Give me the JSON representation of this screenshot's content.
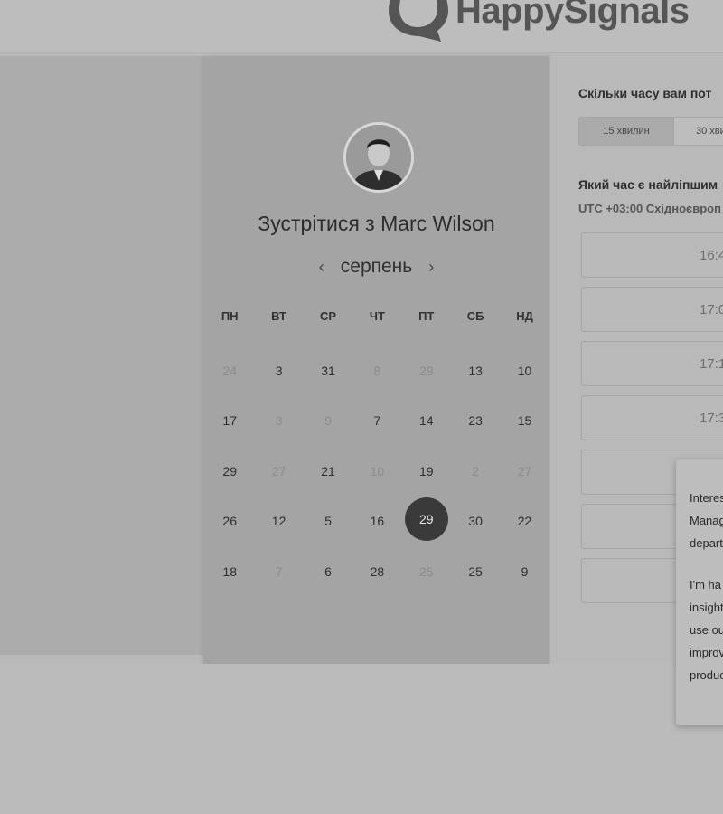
{
  "header": {
    "logo_text": "HappySignals",
    "logo_icon": "happysignals-logo-icon"
  },
  "calendar": {
    "avatar_icon": "profile-photo",
    "title": "Зустрітися з Marc Wilson",
    "month": "серпень",
    "prev_icon": "chevron-left-icon",
    "next_icon": "chevron-right-icon",
    "prev_symbol": "‹",
    "next_symbol": "›",
    "weekdays": [
      "ПН",
      "ВТ",
      "СР",
      "ЧТ",
      "ПТ",
      "СБ",
      "НД"
    ],
    "weeks": [
      [
        {
          "d": "24",
          "state": "disabled"
        },
        {
          "d": "3",
          "state": "available"
        },
        {
          "d": "31",
          "state": "available"
        },
        {
          "d": "8",
          "state": "disabled"
        },
        {
          "d": "29",
          "state": "disabled"
        },
        {
          "d": "13",
          "state": "available"
        },
        {
          "d": "10",
          "state": "available"
        }
      ],
      [
        {
          "d": "17",
          "state": "available"
        },
        {
          "d": "3",
          "state": "disabled"
        },
        {
          "d": "9",
          "state": "disabled"
        },
        {
          "d": "7",
          "state": "available"
        },
        {
          "d": "14",
          "state": "available"
        },
        {
          "d": "23",
          "state": "available"
        },
        {
          "d": "15",
          "state": "available"
        }
      ],
      [
        {
          "d": "29",
          "state": "available"
        },
        {
          "d": "27",
          "state": "disabled"
        },
        {
          "d": "21",
          "state": "available"
        },
        {
          "d": "10",
          "state": "disabled"
        },
        {
          "d": "19",
          "state": "available"
        },
        {
          "d": "2",
          "state": "disabled"
        },
        {
          "d": "27",
          "state": "disabled"
        }
      ],
      [
        {
          "d": "26",
          "state": "available"
        },
        {
          "d": "12",
          "state": "available"
        },
        {
          "d": "5",
          "state": "available"
        },
        {
          "d": "16",
          "state": "available"
        },
        {
          "d": "29",
          "state": "selected"
        },
        {
          "d": "30",
          "state": "available"
        },
        {
          "d": "22",
          "state": "available"
        }
      ],
      [
        {
          "d": "18",
          "state": "available"
        },
        {
          "d": "7",
          "state": "disabled"
        },
        {
          "d": "6",
          "state": "available"
        },
        {
          "d": "28",
          "state": "available"
        },
        {
          "d": "25",
          "state": "disabled"
        },
        {
          "d": "25",
          "state": "available"
        },
        {
          "d": "9",
          "state": "available"
        }
      ]
    ]
  },
  "booking": {
    "duration_question": "Скільки часу вам пот",
    "durations": [
      "15 хвилин",
      "30 хви"
    ],
    "time_question": "Який час є найліпшим",
    "timezone": "UTC +03:00 Східноєвроп",
    "slots": [
      "16:4",
      "17:0",
      "17:1",
      "17:3",
      "",
      "",
      ""
    ]
  },
  "chat_popup": {
    "paragraph1": "Interes\nManag\ndepart",
    "paragraph2": "I'm ha\ninsight\nuse ou\nimprov\nproduc"
  },
  "colors": {
    "selected_day": "#3a3a3a",
    "calendar_bg": "#a4a4a4",
    "page_bg": "#b9b9b9"
  }
}
